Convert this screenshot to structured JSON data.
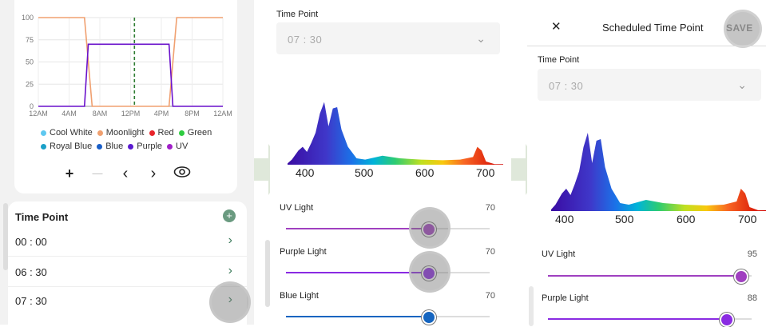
{
  "screen1": {
    "chart_data": {
      "type": "line",
      "x_ticks": [
        "12AM",
        "4AM",
        "8AM",
        "12PM",
        "4PM",
        "8PM",
        "12AM"
      ],
      "y_ticks": [
        "100",
        "75",
        "50",
        "25",
        "0"
      ],
      "ylim": [
        0,
        100
      ],
      "grid": true,
      "current_time_marker": "12:30",
      "series": [
        {
          "name": "Moonlight",
          "color": "#f0a070",
          "points": [
            [
              "0:00",
              100
            ],
            [
              "6:00",
              100
            ],
            [
              "7:00",
              0
            ],
            [
              "17:00",
              0
            ],
            [
              "18:00",
              100
            ],
            [
              "24:00",
              100
            ]
          ]
        },
        {
          "name": "Purple",
          "color": "#6a11cb",
          "points": [
            [
              "0:00",
              0
            ],
            [
              "6:00",
              0
            ],
            [
              "6:30",
              70
            ],
            [
              "17:00",
              70
            ],
            [
              "17:30",
              0
            ],
            [
              "24:00",
              0
            ]
          ]
        }
      ],
      "legend": [
        {
          "name": "Cool White",
          "color": "#5ec8f0"
        },
        {
          "name": "Moonlight",
          "color": "#f0a070"
        },
        {
          "name": "Red",
          "color": "#e8242a"
        },
        {
          "name": "Green",
          "color": "#2ecc40"
        },
        {
          "name": "Royal Blue",
          "color": "#1aa0c8"
        },
        {
          "name": "Blue",
          "color": "#1a5fc8"
        },
        {
          "name": "Purple",
          "color": "#5a1ad0"
        },
        {
          "name": "UV",
          "color": "#a020c8"
        }
      ]
    },
    "controls": {
      "add": "+",
      "remove": "—",
      "prev": "‹",
      "next": "›",
      "eye_icon": "eye-icon"
    },
    "time_point_header": "Time Point",
    "add_icon": "+",
    "time_points": [
      {
        "time": "00 : 00",
        "chev": "›"
      },
      {
        "time": "06 : 30",
        "chev": "›"
      },
      {
        "time": "07 : 30",
        "chev": "›"
      }
    ]
  },
  "screen2": {
    "time_point_label": "Time Point",
    "time_value": "07 : 30",
    "spectrum_ticks": [
      "400",
      "500",
      "600",
      "700"
    ],
    "sliders": [
      {
        "label": "UV Light",
        "value": "70",
        "level": 0.7,
        "color": "#a040c0"
      },
      {
        "label": "Purple Light",
        "value": "70",
        "level": 0.7,
        "color": "#8a2be2"
      },
      {
        "label": "Blue Light",
        "value": "70",
        "level": 0.7,
        "color": "#1565c0"
      }
    ]
  },
  "screen3": {
    "close": "✕",
    "title": "Scheduled Time Point",
    "save": "SAVE",
    "time_point_label": "Time Point",
    "time_value": "07 : 30",
    "spectrum_ticks": [
      "400",
      "500",
      "600",
      "700"
    ],
    "sliders": [
      {
        "label": "UV Light",
        "value": "95",
        "level": 0.95,
        "color": "#a040c0"
      },
      {
        "label": "Purple Light",
        "value": "88",
        "level": 0.88,
        "color": "#8a2be2"
      }
    ]
  },
  "colors": {
    "accent_green": "#3b7a5a",
    "arrow": "#dfe8da"
  }
}
